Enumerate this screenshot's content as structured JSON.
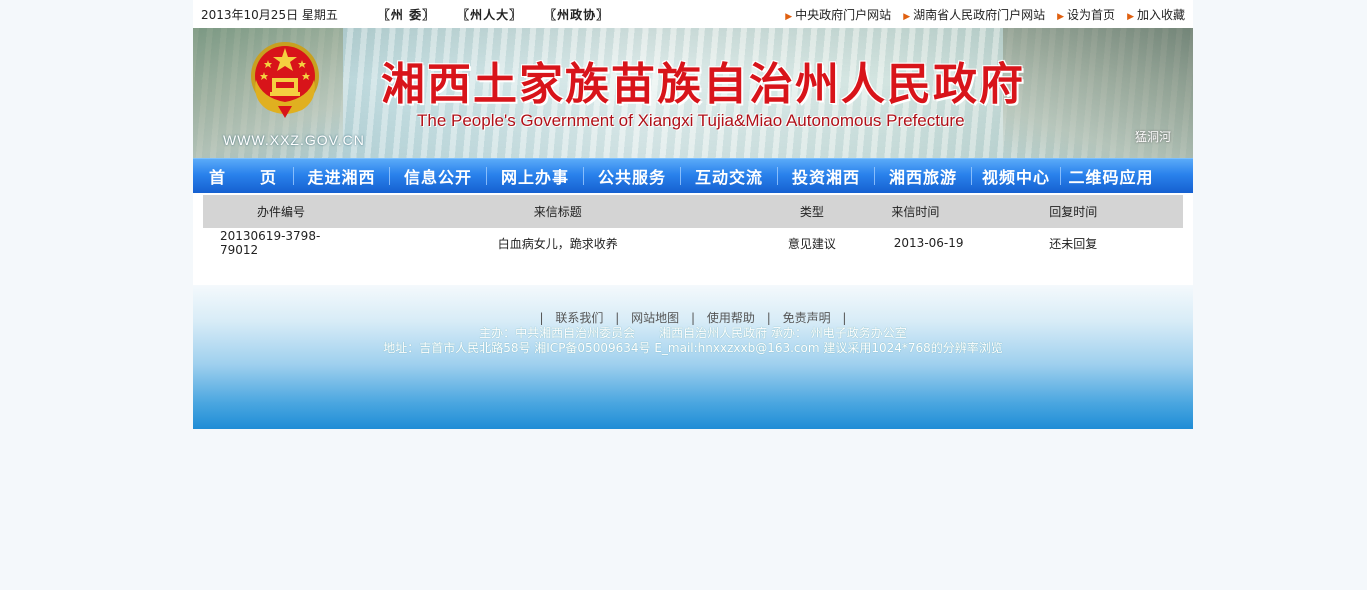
{
  "topbar": {
    "date": "2013年10月25日  星期五",
    "quick_links": [
      "〖州 委〗",
      "〖州人大〗",
      "〖州政协〗"
    ],
    "right_links": [
      "中央政府门户网站",
      "湖南省人民政府门户网站",
      "设为首页",
      "加入收藏"
    ]
  },
  "banner": {
    "title_cn": "湘西土家族苗族自治州人民政府",
    "title_en": "The People's Government  of Xiangxi Tujia&Miao Autonomous Prefecture",
    "site_url": "WWW.XXZ.GOV.CN",
    "caption": "猛洞河"
  },
  "nav": [
    "首　　页",
    "走进湘西",
    "信息公开",
    "网上办事",
    "公共服务",
    "互动交流",
    "投资湘西",
    "湘西旅游",
    "视频中心",
    "二维码应用"
  ],
  "table": {
    "headers": [
      "办件编号",
      "来信标题",
      "类型",
      "来信时间",
      "回复时间"
    ],
    "rows": [
      [
        "20130619-3798-79012",
        "白血病女儿，跪求收养",
        "意见建议",
        "2013-06-19",
        "还未回复"
      ]
    ]
  },
  "footer": {
    "links": [
      "联系我们",
      "网站地图",
      "使用帮助",
      "免责声明"
    ],
    "line1": "主办：中共湘西自治州委员会　　湘西自治州人民政府  承办： 州电子政务办公室",
    "line2": "地址：吉首市人民北路58号  湘ICP备05009634号  E_mail:hnxxzxxb@163.com  建议采用1024*768的分辨率浏览"
  }
}
